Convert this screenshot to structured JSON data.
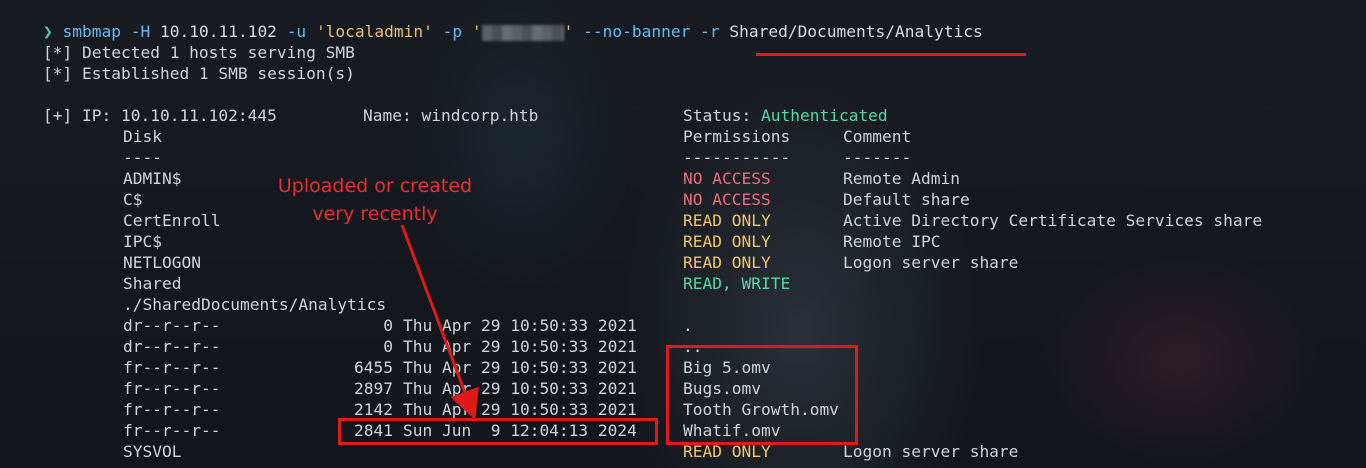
{
  "command": {
    "prompt": "❯",
    "program": "smbmap",
    "flag_host": "-H",
    "host": "10.10.11.102",
    "flag_user": "-u",
    "user": "'localadmin'",
    "flag_pass": "-p",
    "pass_open": "'",
    "pass_close": "'",
    "flag_nobanner": "--no-banner",
    "flag_recurse": "-r",
    "path": "Shared/Documents/Analytics"
  },
  "messages": [
    "[*] Detected 1 hosts serving SMB",
    "[*] Established 1 SMB session(s)"
  ],
  "host_line": {
    "ip": "[+] IP: 10.10.11.102:445",
    "name": "Name: windcorp.htb",
    "status_label": "Status:",
    "status_value": "Authenticated"
  },
  "headers": {
    "disk": "Disk",
    "disk_sep": "----",
    "permissions": "Permissions",
    "permissions_sep": "-----------",
    "comment": "Comment",
    "comment_sep": "-------"
  },
  "shares": [
    {
      "name": "ADMIN$",
      "perm": "NO ACCESS",
      "comment": "Remote Admin",
      "color": "#f06b7a"
    },
    {
      "name": "C$",
      "perm": "NO ACCESS",
      "comment": "Default share",
      "color": "#f06b7a"
    },
    {
      "name": "CertEnroll",
      "perm": "READ ONLY",
      "comment": "Active Directory Certificate Services share",
      "color": "#efc46a"
    },
    {
      "name": "IPC$",
      "perm": "READ ONLY",
      "comment": "Remote IPC",
      "color": "#efc46a"
    },
    {
      "name": "NETLOGON",
      "perm": "READ ONLY",
      "comment": "Logon server share",
      "color": "#efc46a"
    },
    {
      "name": "Shared",
      "perm": "READ, WRITE",
      "comment": "",
      "color": "#59d7a0"
    }
  ],
  "listing_path": "./SharedDocuments/Analytics",
  "files": [
    {
      "mode": "dr--r--r--",
      "size": "0",
      "date": "Thu Apr 29 10:50:33 2021",
      "name": "."
    },
    {
      "mode": "dr--r--r--",
      "size": "0",
      "date": "Thu Apr 29 10:50:33 2021",
      "name": ".."
    },
    {
      "mode": "fr--r--r--",
      "size": "6455",
      "date": "Thu Apr 29 10:50:33 2021",
      "name": "Big 5.omv"
    },
    {
      "mode": "fr--r--r--",
      "size": "2897",
      "date": "Thu Apr 29 10:50:33 2021",
      "name": "Bugs.omv"
    },
    {
      "mode": "fr--r--r--",
      "size": "2142",
      "date": "Thu Apr 29 10:50:33 2021",
      "name": "Tooth Growth.omv"
    },
    {
      "mode": "fr--r--r--",
      "size": "2841",
      "date": "Sun Jun  9 12:04:13 2024",
      "name": "Whatif.omv"
    }
  ],
  "last_share": {
    "name": "SYSVOL",
    "perm": "READ ONLY",
    "comment": "Logon server share",
    "color": "#efc46a"
  },
  "annotation": {
    "line1": "Uploaded or created",
    "line2": "very recently",
    "color": "#e01919"
  }
}
